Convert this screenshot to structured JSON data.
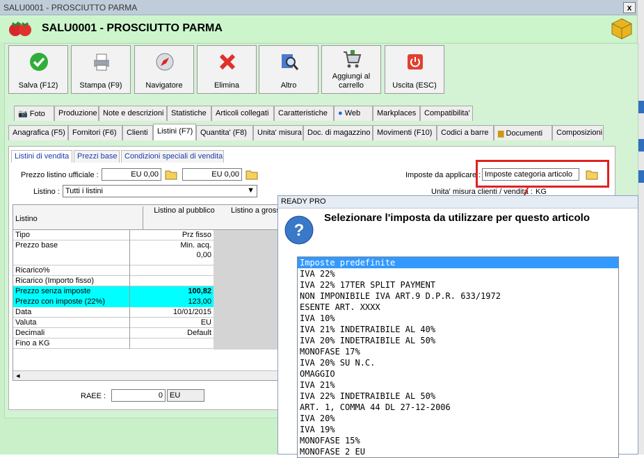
{
  "window": {
    "title": "SALU0001 - PROSCIUTTO PARMA",
    "close": "x"
  },
  "header": {
    "title": "SALU0001 - PROSCIUTTO PARMA"
  },
  "toolbar": [
    {
      "label": "Salva (F12)",
      "icon": "check-icon"
    },
    {
      "label": "Stampa (F9)",
      "icon": "printer-icon"
    },
    {
      "label": "Navigatore",
      "icon": "compass-icon"
    },
    {
      "label": "Elimina",
      "icon": "delete-x-icon"
    },
    {
      "label": "Altro",
      "icon": "magnifier-icon"
    },
    {
      "label": "Aggiungi al carrello",
      "icon": "cart-icon"
    },
    {
      "label": "Uscita (ESC)",
      "icon": "power-icon"
    }
  ],
  "tabs_row1": [
    "Foto",
    "Produzione",
    "Note e descrizioni",
    "Statistiche",
    "Articoli collegati",
    "Caratteristiche",
    "Web",
    "Markplaces",
    "Compatibilita'"
  ],
  "tabs_row2": [
    "Anagrafica (F5)",
    "Fornitori (F6)",
    "Clienti",
    "Listini (F7)",
    "Quantita' (F8)",
    "Unita' misura",
    "Doc. di magazzino",
    "Movimenti (F10)",
    "Codici a barre",
    "Documenti",
    "Composizioni"
  ],
  "subtabs": [
    "Listini di vendita",
    "Prezzi base",
    "Condizioni speciali di vendita"
  ],
  "form": {
    "prezzo_label": "Prezzo listino ufficiale :",
    "prezzo1": "EU 0,00",
    "prezzo2": "EU 0,00",
    "listino_label": "Listino :",
    "listino_value": "Tutti i listini",
    "imposte_label": "Imposte da applicare :",
    "imposte_value": "Imposte categoria articolo",
    "unita_label": "Unita' misura clienti / vendita :",
    "unita_value": "KG",
    "raee_label": "RAEE :",
    "raee_value": "0",
    "raee_unit": "EU"
  },
  "grid": {
    "header": [
      "Listino",
      "Listino al pubblico",
      "Listino a grossista"
    ],
    "rows": [
      {
        "label": "Tipo",
        "value": "Prz fisso"
      },
      {
        "label": "Prezzo base",
        "value": "Min. acq.",
        "value2": "0,00"
      },
      {
        "label": "Ricarico%",
        "value": ""
      },
      {
        "label": "Ricarico (Importo fisso)",
        "value": ""
      },
      {
        "label": "Prezzo senza imposte",
        "value": "100,82"
      },
      {
        "label": "Prezzo con imposte (22%)",
        "value": "123,00"
      },
      {
        "label": "Data",
        "value": "10/01/2015"
      },
      {
        "label": "Valuta",
        "value": "EU"
      },
      {
        "label": "Decimali",
        "value": "Default"
      },
      {
        "label": "Fino a KG",
        "value": ""
      }
    ]
  },
  "dialog": {
    "title": "READY PRO",
    "question": "Selezionare l'imposta da utilizzare per questo articolo",
    "items": [
      "Imposte predefinite",
      "IVA 22%",
      "IVA 22% 17TER SPLIT PAYMENT",
      "NON IMPONIBILE IVA ART.9 D.P.R. 633/1972",
      "ESENTE ART. XXXX",
      "IVA 10%",
      "IVA 21% INDETRAIBILE AL 40%",
      "IVA 20% INDETRAIBILE AL 50%",
      "MONOFASE 17%",
      "IVA 20% SU N.C.",
      "OMAGGIO",
      "IVA 21%",
      "IVA 22% INDETRAIBILE AL 50%",
      "ART. 1, COMMA 44 DL 27-12-2006",
      "IVA 20%",
      "IVA 19%",
      "MONOFASE 15%",
      "MONOFASE 2 EU"
    ]
  },
  "colors": {
    "accent": "#3399ff",
    "highlight": "#00ffff",
    "annotation": "#e02020"
  }
}
